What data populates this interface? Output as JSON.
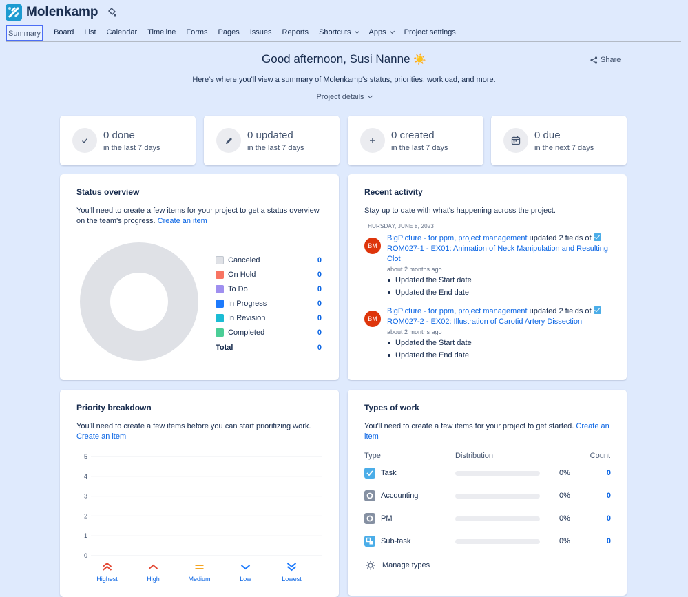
{
  "project": {
    "name": "Molenkamp"
  },
  "tabs": [
    {
      "label": "Summary"
    },
    {
      "label": "Board"
    },
    {
      "label": "List"
    },
    {
      "label": "Calendar"
    },
    {
      "label": "Timeline"
    },
    {
      "label": "Forms"
    },
    {
      "label": "Pages"
    },
    {
      "label": "Issues"
    },
    {
      "label": "Reports"
    },
    {
      "label": "Shortcuts"
    },
    {
      "label": "Apps"
    },
    {
      "label": "Project settings"
    }
  ],
  "header": {
    "greeting": "Good afternoon, Susi Nanne",
    "greeting_emoji": "☀️",
    "share_label": "Share",
    "subline": "Here's where you'll view a summary of Molenkamp's status, priorities, workload, and more.",
    "project_details_label": "Project details"
  },
  "stats": [
    {
      "value": "0 done",
      "sub": "in the last 7 days",
      "icon": "check-icon"
    },
    {
      "value": "0 updated",
      "sub": "in the last 7 days",
      "icon": "pencil-icon"
    },
    {
      "value": "0 created",
      "sub": "in the last 7 days",
      "icon": "plus-icon"
    },
    {
      "value": "0 due",
      "sub": "in the next 7 days",
      "icon": "calendar-icon"
    }
  ],
  "status_overview": {
    "title": "Status overview",
    "text": "You'll need to create a few items for your project to get a status overview on the team's progress.",
    "link": "Create an item",
    "legend": [
      {
        "label": "Canceled",
        "value": "0",
        "color": "#dfe1e6"
      },
      {
        "label": "On Hold",
        "value": "0",
        "color": "#f87462"
      },
      {
        "label": "To Do",
        "value": "0",
        "color": "#9f8fef"
      },
      {
        "label": "In Progress",
        "value": "0",
        "color": "#1d7afc"
      },
      {
        "label": "In Revision",
        "value": "0",
        "color": "#1bbcd4"
      },
      {
        "label": "Completed",
        "value": "0",
        "color": "#4bce97"
      }
    ],
    "total_label": "Total",
    "total_value": "0"
  },
  "recent_activity": {
    "title": "Recent activity",
    "text": "Stay up to date with what's happening across the project.",
    "date": "THURSDAY, JUNE 8, 2023",
    "items": [
      {
        "avatar": "BM",
        "actor": "BigPicture - for ppm, project management",
        "verb": " updated 2 fields of ",
        "issue": "ROM027-1 - EX01: Animation of Neck Manipulation and Resulting Clot",
        "time": "about 2 months ago",
        "changes": [
          "Updated the Start date",
          "Updated the End date"
        ]
      },
      {
        "avatar": "BM",
        "actor": "BigPicture - for ppm, project management",
        "verb": " updated 2 fields of ",
        "issue": "ROM027-2 - EX02: Illustration of Carotid Artery Dissection",
        "time": "about 2 months ago",
        "changes": [
          "Updated the Start date",
          "Updated the End date"
        ]
      }
    ]
  },
  "priority": {
    "title": "Priority breakdown",
    "text": "You'll need to create a few items before you can start prioritizing work.",
    "link": "Create an item",
    "chart_data": {
      "type": "bar",
      "categories": [
        "Highest",
        "High",
        "Medium",
        "Low",
        "Lowest"
      ],
      "values": [
        0,
        0,
        0,
        0,
        0
      ],
      "ylim": [
        0,
        5
      ],
      "yticks": [
        "5",
        "4",
        "3",
        "2",
        "1",
        "0"
      ],
      "colors": [
        "#e34935",
        "#e34935",
        "#f5a623",
        "#1d7afc",
        "#1d7afc"
      ]
    }
  },
  "types_of_work": {
    "title": "Types of work",
    "text": "You'll need to create a few items for your project to get started.",
    "link": "Create an item",
    "col_type": "Type",
    "col_distribution": "Distribution",
    "col_count": "Count",
    "rows": [
      {
        "label": "Task",
        "pct": "0%",
        "count": "0",
        "fill": 0,
        "icon": "task-icon",
        "color": "#4bade8"
      },
      {
        "label": "Accounting",
        "pct": "0%",
        "count": "0",
        "fill": 0,
        "icon": "accounting-icon",
        "color": "#8590a2"
      },
      {
        "label": "PM",
        "pct": "0%",
        "count": "0",
        "fill": 0,
        "icon": "pm-icon",
        "color": "#8590a2"
      },
      {
        "label": "Sub-task",
        "pct": "0%",
        "count": "0",
        "fill": 0,
        "icon": "subtask-icon",
        "color": "#4bade8"
      }
    ],
    "manage_label": "Manage types"
  }
}
